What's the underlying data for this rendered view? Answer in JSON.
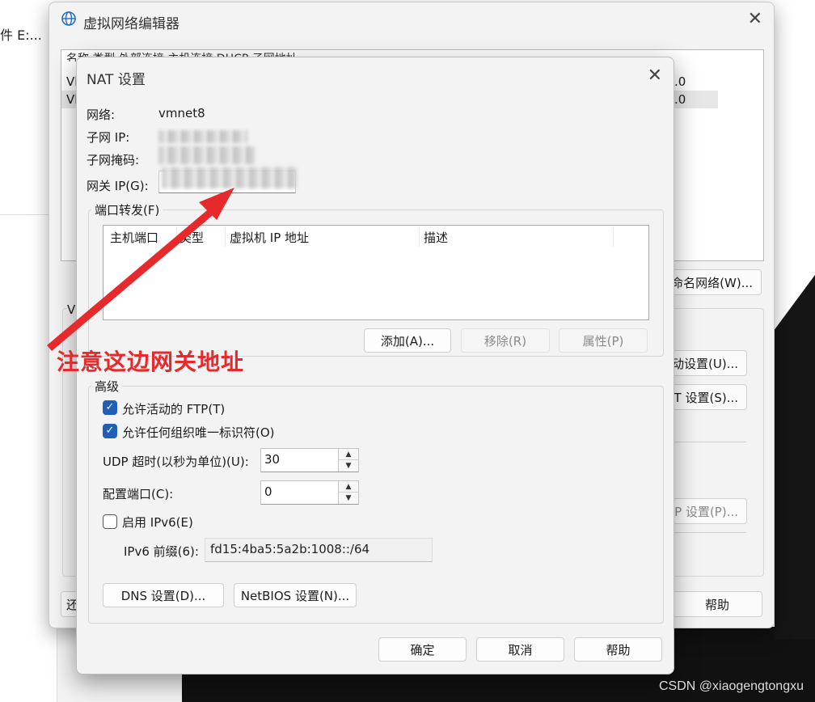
{
  "background": {
    "left_text": "件 E:...",
    "watermark": "CSDN @xiaogengtongxu"
  },
  "vne": {
    "title": "虚拟网络编辑器",
    "list_header": "名称      类型      外部连接            主机连接      DHCP    子网地址",
    "rows": [
      {
        "name": "Vl",
        "subnet": ".0"
      },
      {
        "name": "Vl",
        "subnet": ".0"
      }
    ],
    "buttons": {
      "rename": "命名网络(W)...",
      "settings_u": "动设置(U)...",
      "nat_settings": "T 设置(S)...",
      "dhcp_settings": "P 设置(P)...",
      "help": "帮助",
      "restore": "还"
    },
    "group_label": "V"
  },
  "nat": {
    "title": "NAT 设置",
    "network_label": "网络:",
    "network_value": "vmnet8",
    "subnet_ip_label": "子网 IP:",
    "subnet_mask_label": "子网掩码:",
    "gateway_label": "网关 IP(G):",
    "port_forward_legend": "端口转发(F)",
    "pf_columns": [
      "主机端口",
      "类型",
      "虚拟机 IP 地址",
      "描述"
    ],
    "add_button": "添加(A)...",
    "remove_button": "移除(R)",
    "properties_button": "属性(P)",
    "advanced_legend": "高级",
    "allow_ftp": {
      "label": "允许活动的 FTP(T)",
      "checked": true
    },
    "allow_oui": {
      "label": "允许任何组织唯一标识符(O)",
      "checked": true
    },
    "udp_timeout_label": "UDP 超时(以秒为单位)(U):",
    "udp_timeout_value": "30",
    "config_port_label": "配置端口(C):",
    "config_port_value": "0",
    "enable_ipv6": {
      "label": "启用 IPv6(E)",
      "checked": false
    },
    "ipv6_prefix_label": "IPv6 前缀(6):",
    "ipv6_prefix_value": "fd15:4ba5:5a2b:1008::/64",
    "dns_button": "DNS 设置(D)...",
    "netbios_button": "NetBIOS 设置(N)...",
    "ok_button": "确定",
    "cancel_button": "取消",
    "help_button": "帮助"
  },
  "annotation": {
    "text": "注意这边网关地址",
    "color": "#e8292b"
  },
  "colors": {
    "accent": "#1f5fb8",
    "dialog_bg": "#f3f3f3"
  }
}
